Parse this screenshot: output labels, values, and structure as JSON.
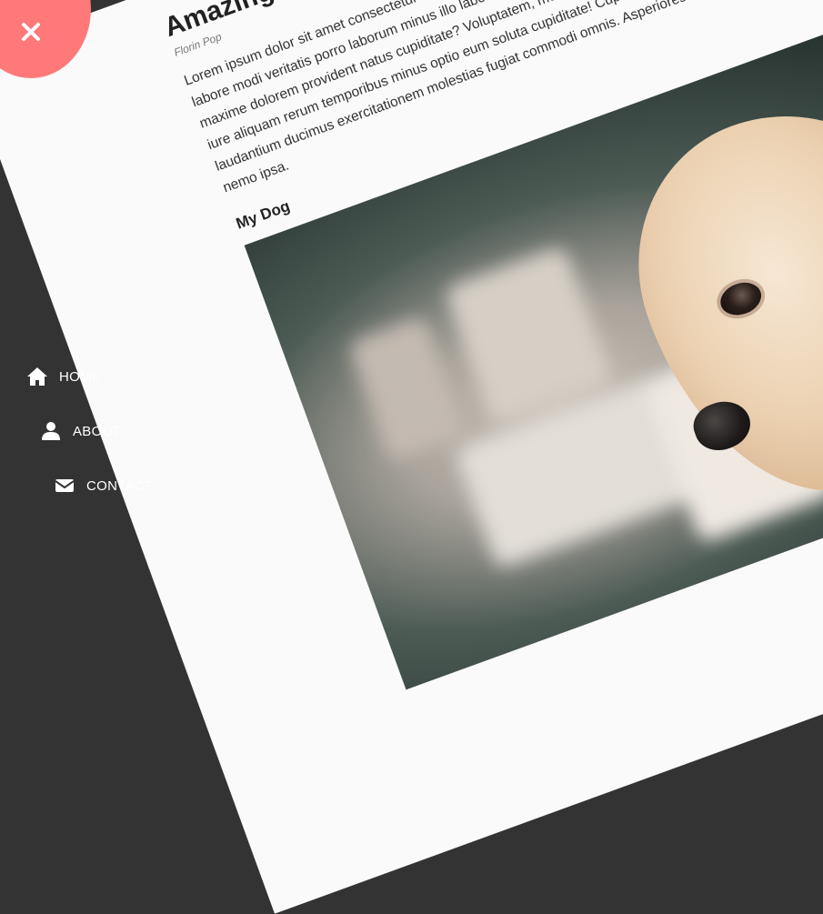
{
  "article": {
    "title": "Amazing Article",
    "author": "Florin Pop",
    "body": "Lorem ipsum dolor sit amet consectetur adipisicing elit. Sunt cupiditate dolor omnis atque fuga labore modi veritatis porro laborum minus illo labore pariatur sunt quia harum aut. Eum maxime dolorem provident natus cupiditate? Voluptatem, molestias culpa. Corrupti, laudantium iure aliquam rerum temporibus minus optio eum soluta cupiditate! Cupiditate saepe voluptates laudantium ducimus exercitationem molestias fugiat commodi omnis. Asperiores quia tenetur nemo ipsa.",
    "subheading": "My Dog"
  },
  "nav": {
    "items": [
      {
        "label": "HOME",
        "icon": "home-icon"
      },
      {
        "label": "ABOUT",
        "icon": "user-icon"
      },
      {
        "label": "CONTACT",
        "icon": "envelope-icon"
      }
    ]
  },
  "colors": {
    "sidebar": "#333333",
    "close_circle": "#ff7979",
    "page": "#fafafa"
  },
  "close_button": {
    "icon": "close-icon"
  }
}
